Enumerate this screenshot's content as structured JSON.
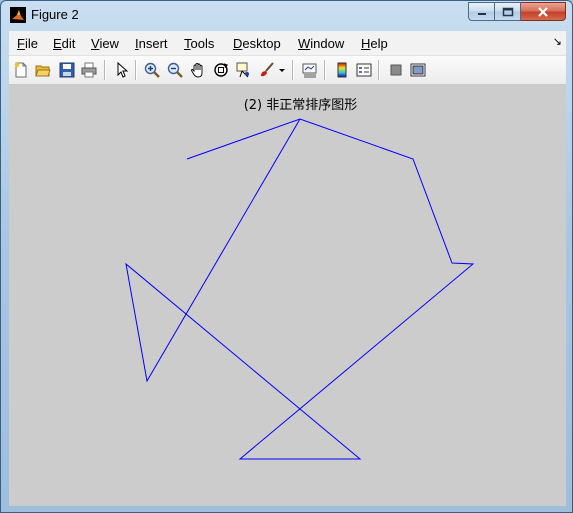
{
  "window": {
    "title": "Figure 2"
  },
  "menu": [
    {
      "prefix": "",
      "key": "F",
      "rest": "ile"
    },
    {
      "prefix": "",
      "key": "E",
      "rest": "dit"
    },
    {
      "prefix": "",
      "key": "V",
      "rest": "iew"
    },
    {
      "prefix": "",
      "key": "I",
      "rest": "nsert"
    },
    {
      "prefix": "",
      "key": "T",
      "rest": "ools"
    },
    {
      "prefix": "",
      "key": "D",
      "rest": "esktop"
    },
    {
      "prefix": "",
      "key": "W",
      "rest": "indow"
    },
    {
      "prefix": "",
      "key": "H",
      "rest": "elp"
    }
  ],
  "toolbar": [
    "new-figure-icon",
    "open-file-icon",
    "save-icon",
    "print-icon",
    "pointer-icon",
    "zoom-in-icon",
    "zoom-out-icon",
    "pan-hand-icon",
    "rotate-3d-icon",
    "data-cursor-icon",
    "brush-icon",
    "brush-dropdown-icon",
    "link-plot-icon",
    "colorbar-icon",
    "legend-icon",
    "hide-plot-tools-icon",
    "show-plot-tools-icon"
  ],
  "plot": {
    "title": "(2) 非正常排序图形",
    "line_color": "#0000ff",
    "background": "#cccccc"
  }
}
